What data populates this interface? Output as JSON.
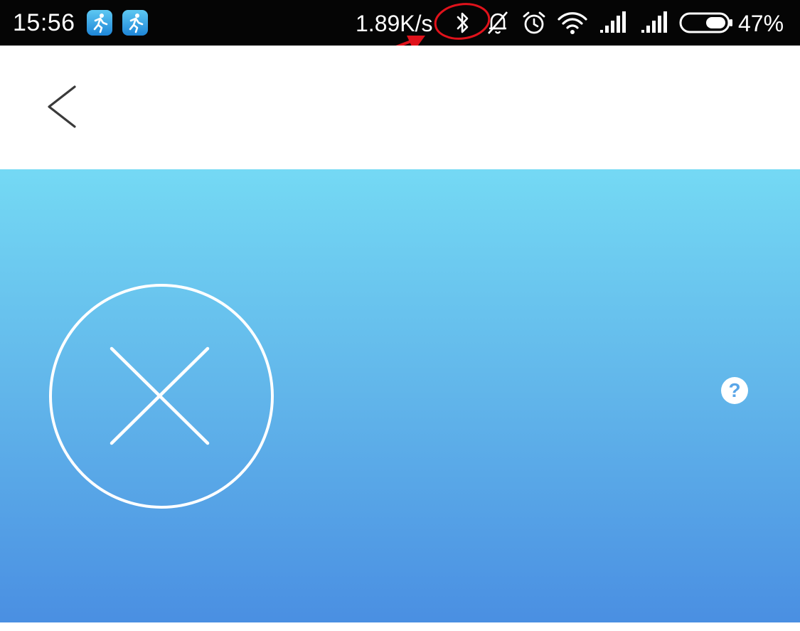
{
  "status_bar": {
    "time": "15:56",
    "network_speed": "1.89K/s",
    "battery_percent": "47%",
    "icons": [
      "app-icon",
      "app-icon",
      "bluetooth-icon",
      "notifications-off-icon",
      "alarm-icon",
      "wifi-icon",
      "signal-icon",
      "signal-icon",
      "battery-icon"
    ]
  },
  "nav_bar": {
    "back_icon": "chevron-left-icon"
  },
  "hero": {
    "status_icon": "close-circle-icon",
    "help_label": "?"
  },
  "annotation": {
    "color": "#e0121b",
    "target": "bluetooth-icon"
  },
  "colors": {
    "status_bar": "#050505",
    "hero_top": "#74d9f4",
    "hero_bottom": "#4a8fe2"
  }
}
